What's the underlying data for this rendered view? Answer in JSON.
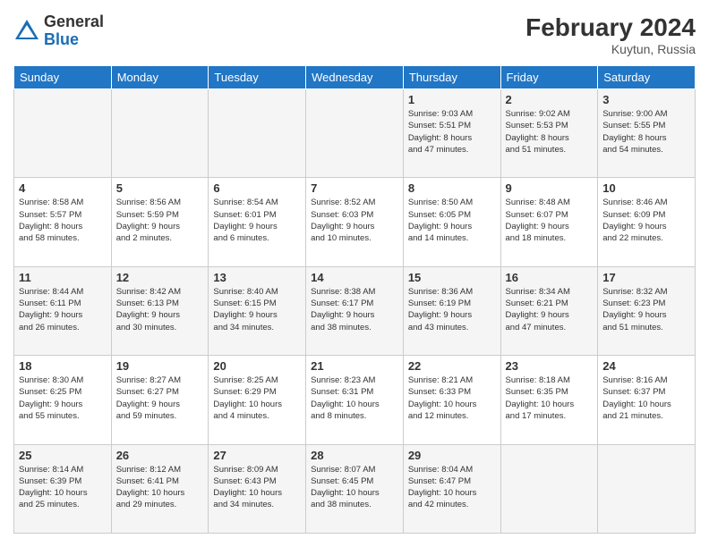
{
  "header": {
    "logo_general": "General",
    "logo_blue": "Blue",
    "title": "February 2024",
    "location": "Kuytun, Russia"
  },
  "weekdays": [
    "Sunday",
    "Monday",
    "Tuesday",
    "Wednesday",
    "Thursday",
    "Friday",
    "Saturday"
  ],
  "weeks": [
    [
      {
        "day": "",
        "info": ""
      },
      {
        "day": "",
        "info": ""
      },
      {
        "day": "",
        "info": ""
      },
      {
        "day": "",
        "info": ""
      },
      {
        "day": "1",
        "info": "Sunrise: 9:03 AM\nSunset: 5:51 PM\nDaylight: 8 hours\nand 47 minutes."
      },
      {
        "day": "2",
        "info": "Sunrise: 9:02 AM\nSunset: 5:53 PM\nDaylight: 8 hours\nand 51 minutes."
      },
      {
        "day": "3",
        "info": "Sunrise: 9:00 AM\nSunset: 5:55 PM\nDaylight: 8 hours\nand 54 minutes."
      }
    ],
    [
      {
        "day": "4",
        "info": "Sunrise: 8:58 AM\nSunset: 5:57 PM\nDaylight: 8 hours\nand 58 minutes."
      },
      {
        "day": "5",
        "info": "Sunrise: 8:56 AM\nSunset: 5:59 PM\nDaylight: 9 hours\nand 2 minutes."
      },
      {
        "day": "6",
        "info": "Sunrise: 8:54 AM\nSunset: 6:01 PM\nDaylight: 9 hours\nand 6 minutes."
      },
      {
        "day": "7",
        "info": "Sunrise: 8:52 AM\nSunset: 6:03 PM\nDaylight: 9 hours\nand 10 minutes."
      },
      {
        "day": "8",
        "info": "Sunrise: 8:50 AM\nSunset: 6:05 PM\nDaylight: 9 hours\nand 14 minutes."
      },
      {
        "day": "9",
        "info": "Sunrise: 8:48 AM\nSunset: 6:07 PM\nDaylight: 9 hours\nand 18 minutes."
      },
      {
        "day": "10",
        "info": "Sunrise: 8:46 AM\nSunset: 6:09 PM\nDaylight: 9 hours\nand 22 minutes."
      }
    ],
    [
      {
        "day": "11",
        "info": "Sunrise: 8:44 AM\nSunset: 6:11 PM\nDaylight: 9 hours\nand 26 minutes."
      },
      {
        "day": "12",
        "info": "Sunrise: 8:42 AM\nSunset: 6:13 PM\nDaylight: 9 hours\nand 30 minutes."
      },
      {
        "day": "13",
        "info": "Sunrise: 8:40 AM\nSunset: 6:15 PM\nDaylight: 9 hours\nand 34 minutes."
      },
      {
        "day": "14",
        "info": "Sunrise: 8:38 AM\nSunset: 6:17 PM\nDaylight: 9 hours\nand 38 minutes."
      },
      {
        "day": "15",
        "info": "Sunrise: 8:36 AM\nSunset: 6:19 PM\nDaylight: 9 hours\nand 43 minutes."
      },
      {
        "day": "16",
        "info": "Sunrise: 8:34 AM\nSunset: 6:21 PM\nDaylight: 9 hours\nand 47 minutes."
      },
      {
        "day": "17",
        "info": "Sunrise: 8:32 AM\nSunset: 6:23 PM\nDaylight: 9 hours\nand 51 minutes."
      }
    ],
    [
      {
        "day": "18",
        "info": "Sunrise: 8:30 AM\nSunset: 6:25 PM\nDaylight: 9 hours\nand 55 minutes."
      },
      {
        "day": "19",
        "info": "Sunrise: 8:27 AM\nSunset: 6:27 PM\nDaylight: 9 hours\nand 59 minutes."
      },
      {
        "day": "20",
        "info": "Sunrise: 8:25 AM\nSunset: 6:29 PM\nDaylight: 10 hours\nand 4 minutes."
      },
      {
        "day": "21",
        "info": "Sunrise: 8:23 AM\nSunset: 6:31 PM\nDaylight: 10 hours\nand 8 minutes."
      },
      {
        "day": "22",
        "info": "Sunrise: 8:21 AM\nSunset: 6:33 PM\nDaylight: 10 hours\nand 12 minutes."
      },
      {
        "day": "23",
        "info": "Sunrise: 8:18 AM\nSunset: 6:35 PM\nDaylight: 10 hours\nand 17 minutes."
      },
      {
        "day": "24",
        "info": "Sunrise: 8:16 AM\nSunset: 6:37 PM\nDaylight: 10 hours\nand 21 minutes."
      }
    ],
    [
      {
        "day": "25",
        "info": "Sunrise: 8:14 AM\nSunset: 6:39 PM\nDaylight: 10 hours\nand 25 minutes."
      },
      {
        "day": "26",
        "info": "Sunrise: 8:12 AM\nSunset: 6:41 PM\nDaylight: 10 hours\nand 29 minutes."
      },
      {
        "day": "27",
        "info": "Sunrise: 8:09 AM\nSunset: 6:43 PM\nDaylight: 10 hours\nand 34 minutes."
      },
      {
        "day": "28",
        "info": "Sunrise: 8:07 AM\nSunset: 6:45 PM\nDaylight: 10 hours\nand 38 minutes."
      },
      {
        "day": "29",
        "info": "Sunrise: 8:04 AM\nSunset: 6:47 PM\nDaylight: 10 hours\nand 42 minutes."
      },
      {
        "day": "",
        "info": ""
      },
      {
        "day": "",
        "info": ""
      }
    ]
  ]
}
